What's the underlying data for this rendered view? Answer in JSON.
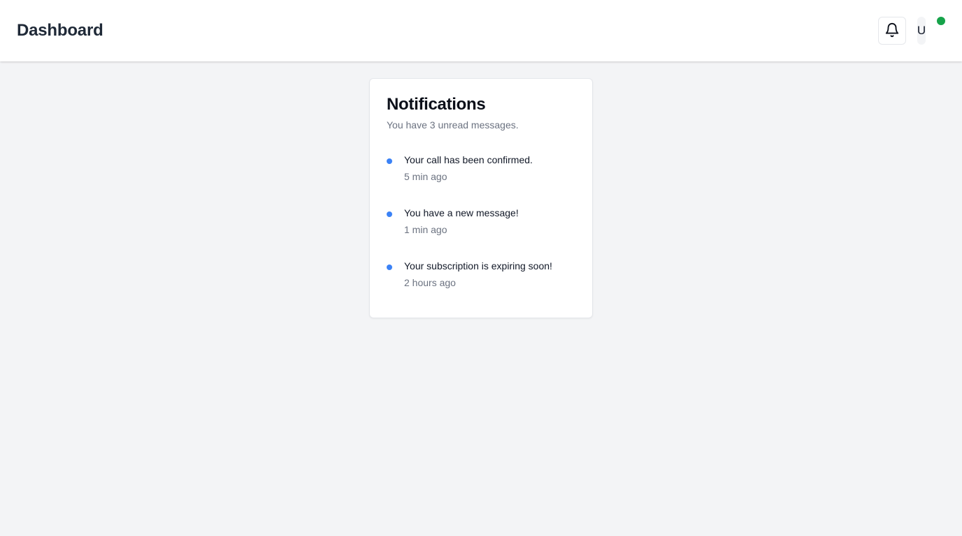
{
  "header": {
    "title": "Dashboard",
    "notifications_icon": "bell-icon",
    "avatar_initial": "U",
    "status_color": "#16a34a"
  },
  "notifications": {
    "title": "Notifications",
    "subtitle": "You have 3 unread messages.",
    "dot_color": "#3b82f6",
    "items": [
      {
        "message": "Your call has been confirmed.",
        "time": "5 min ago"
      },
      {
        "message": "You have a new message!",
        "time": "1 min ago"
      },
      {
        "message": "Your subscription is expiring soon!",
        "time": "2 hours ago"
      }
    ]
  }
}
